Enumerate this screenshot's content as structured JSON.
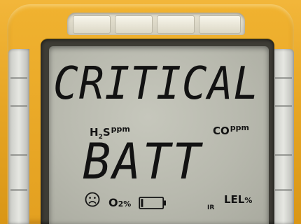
{
  "device": {
    "name": "gas detector",
    "housing_color": "#e7a625",
    "lcd_color": "#bcbdb2"
  },
  "display": {
    "line1": "CRITICAL",
    "line2": "BATT"
  },
  "indicators": {
    "h2s": {
      "label": "H",
      "sub": "2",
      "tail": "S",
      "unit": "ppm"
    },
    "co": {
      "label": "CO",
      "unit": "ppm"
    },
    "o2": {
      "label": "O",
      "sub": "2",
      "unit": "%"
    },
    "lel": {
      "label": "LEL",
      "unit": "%"
    },
    "ir": {
      "label": "IR"
    },
    "status_face": "sad-face-icon",
    "battery": {
      "icon": "battery-icon",
      "level": 0.1
    }
  }
}
